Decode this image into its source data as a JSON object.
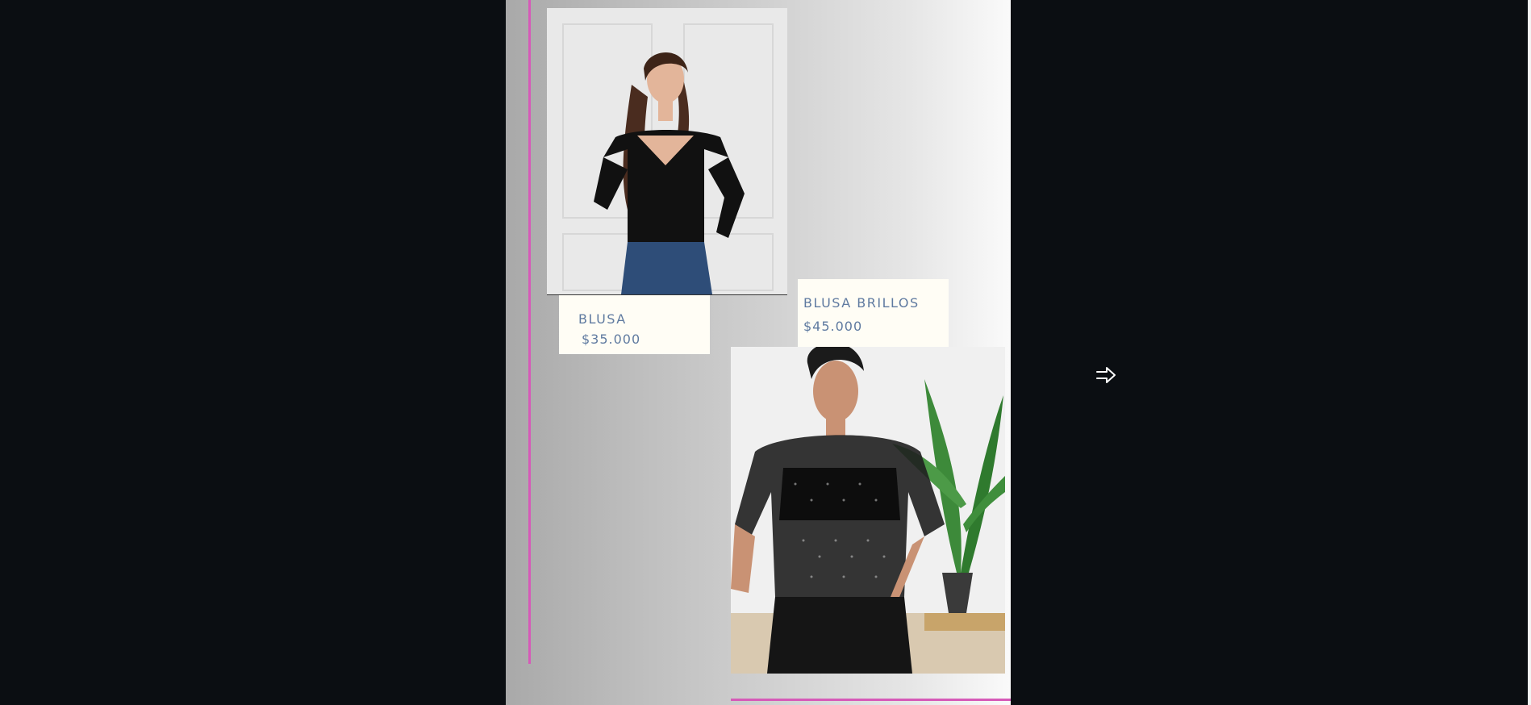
{
  "products": [
    {
      "name": "BLUSA",
      "price": "$35.000",
      "image": "woman-black-off-shoulder-blouse"
    },
    {
      "name": "BLUSA BRILLOS",
      "price": "$45.000",
      "image": "woman-sheer-sparkle-top"
    }
  ],
  "navigation": {
    "next_icon": "arrow-right-icon"
  },
  "colors": {
    "accent": "#d65ab8",
    "label_text": "#5f7aa0",
    "card_background": "#fffdf5",
    "page_background": "#0b0e12"
  }
}
